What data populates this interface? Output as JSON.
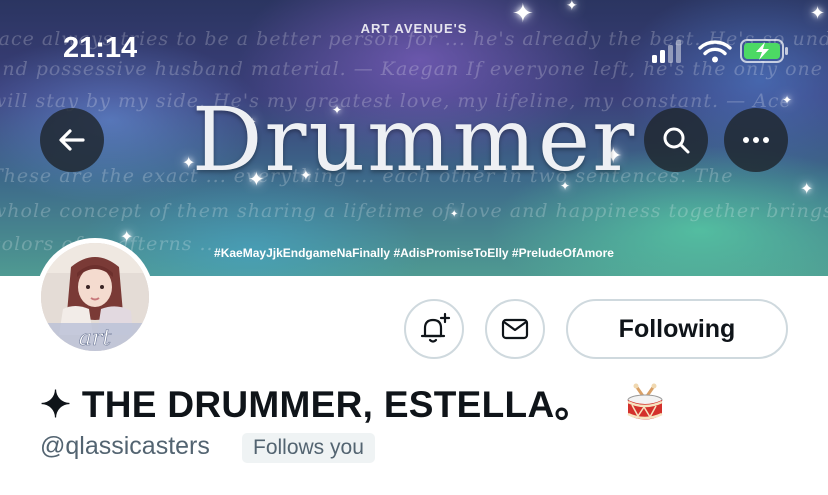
{
  "status_bar": {
    "time": "21:14"
  },
  "banner": {
    "brand": "ART AVENUE'S",
    "title": "Drummer",
    "hashtags": "#KaeMayJjkEndgameNaFinally #AdisPromiseToElly #PreludeOfAmore",
    "script_lines": [
      "Jace always tries to be a better person for ... he's already the best. He's so understanding",
      "and possessive husband material. — Kaegan  If everyone left, he's the only one whom I know",
      "will stay by my side. He's my greatest love, my lifeline, my constant. — Ace",
      "These are the exact ... everything ... each other in two sentences. The",
      "whole concept of them sharing a lifetime of love and happiness together brings nothing but the joy and bright",
      "colors of ... afterns ... "
    ]
  },
  "profile": {
    "display_name": "✦ THE DRUMMER, ESTELLA。",
    "name_emoji": "drum-emoji",
    "handle": "@qlassicasters",
    "follows_you": "Follows you",
    "following_label": "Following"
  },
  "icons": {
    "back": "back-arrow-icon",
    "search": "search-icon",
    "more": "more-icon",
    "notify": "bell-plus-icon",
    "message": "envelope-icon"
  },
  "colors": {
    "text_primary": "#0f1419",
    "text_secondary": "#536471",
    "border": "#cfd9de",
    "battery_green": "#4cd964"
  }
}
